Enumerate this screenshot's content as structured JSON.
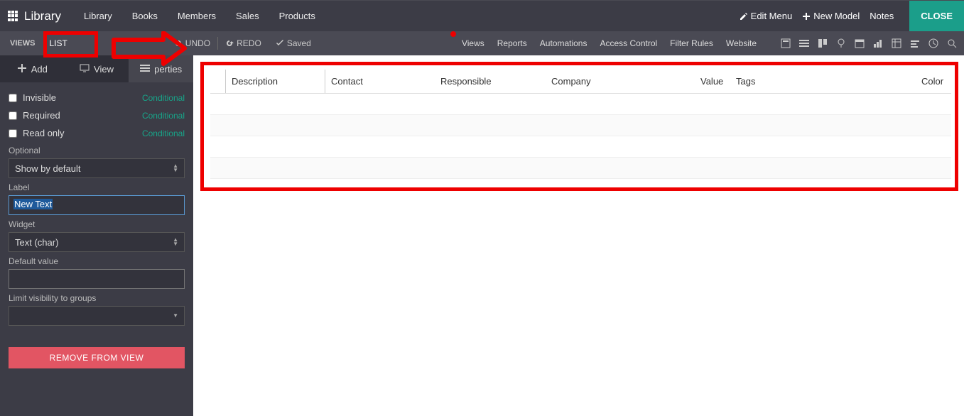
{
  "top": {
    "brand": "Library",
    "menu": [
      "Library",
      "Books",
      "Members",
      "Sales",
      "Products"
    ],
    "editMenu": "Edit Menu",
    "newModel": "New Model",
    "notes": "Notes",
    "close": "CLOSE"
  },
  "toolbar": {
    "viewsLabel": "VIEWS",
    "listTab": "LIST",
    "undo": "UNDO",
    "redo": "REDO",
    "saved": "Saved",
    "links": [
      "Views",
      "Reports",
      "Automations",
      "Access Control",
      "Filter Rules",
      "Website"
    ],
    "icons": [
      "form-icon",
      "list-icon",
      "kanban-icon",
      "map-icon",
      "calendar-icon",
      "graph-icon",
      "pivot-icon",
      "activity-icon",
      "clock-icon",
      "search-icon"
    ]
  },
  "sidebar": {
    "tabs": {
      "add": "Add",
      "view": "View",
      "props": "perties"
    },
    "invisible": "Invisible",
    "required": "Required",
    "readonly": "Read only",
    "conditional": "Conditional",
    "optionalLabel": "Optional",
    "optionalValue": "Show by default",
    "labelLabel": "Label",
    "labelValue": "New Text",
    "widgetLabel": "Widget",
    "widgetValue": "Text (char)",
    "defaultLabel": "Default value",
    "defaultValue": "",
    "limitLabel": "Limit visibility to groups",
    "removeBtn": "REMOVE FROM VIEW"
  },
  "table": {
    "headers": {
      "desc": "Description",
      "contact": "Contact",
      "resp": "Responsible",
      "comp": "Company",
      "value": "Value",
      "tags": "Tags",
      "color": "Color"
    }
  }
}
